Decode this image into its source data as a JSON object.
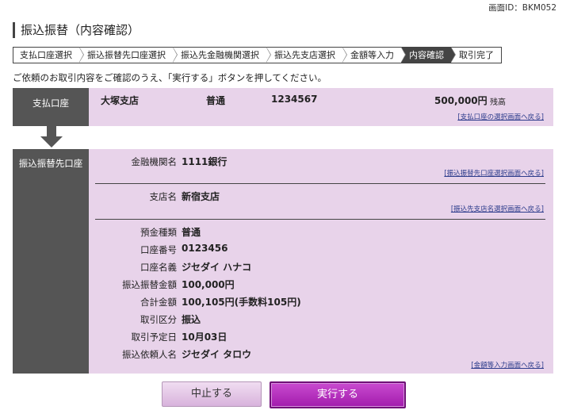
{
  "screen_id": "画面ID：BKM052",
  "page_title": "振込振替（内容確認）",
  "steps": [
    "支払口座選択",
    "振込振替先口座選択",
    "振込先金融機関選択",
    "振込先支店選択",
    "金額等入力",
    "内容確認",
    "取引完了"
  ],
  "active_step": "内容確認",
  "instruction": "ご依頼のお取引内容をご確認のうえ、「実行する」ボタンを押してください。",
  "payment_account": {
    "header": "支払口座",
    "branch": "大塚支店",
    "type": "普通",
    "number": "1234567",
    "balance": "500,000円",
    "balance_label": "残高",
    "link": "[支払口座の選択画面へ戻る]"
  },
  "transfer_account": {
    "header": "振込振替先口座",
    "bank_label": "金融機関名",
    "bank_value": "1111銀行",
    "bank_link": "[振込振替先口座選択画面へ戻る]",
    "branch_label": "支店名",
    "branch_value": "新宿支店",
    "branch_link": "[振込先支店名選択画面へ戻る]",
    "rows": [
      {
        "label": "預金種類",
        "value": "普通"
      },
      {
        "label": "口座番号",
        "value": "0123456"
      },
      {
        "label": "口座名義",
        "value": "ジセダイ ハナコ"
      },
      {
        "label": "振込振替金額",
        "value": "100,000円"
      },
      {
        "label": "合計金額",
        "value": "100,105円(手数料105円)"
      },
      {
        "label": "取引区分",
        "value": "振込"
      },
      {
        "label": "取引予定日",
        "value": "10月03日"
      },
      {
        "label": "振込依頼人名",
        "value": "ジセダイ タロウ"
      }
    ],
    "amount_link": "[金額等入力画面へ戻る]"
  },
  "buttons": {
    "cancel": "中止する",
    "execute": "実行する"
  },
  "colors": {
    "panel_bg": "#e8d3ea",
    "label_bg": "#555555",
    "execute_button": "#a21bac",
    "link": "#2d3c8c"
  }
}
